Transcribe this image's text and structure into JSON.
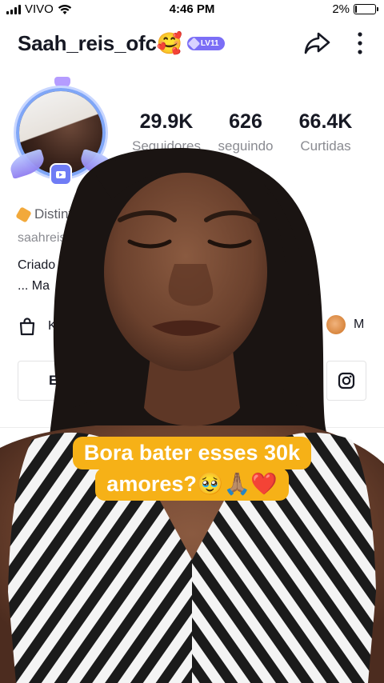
{
  "status_bar": {
    "carrier": "VIVO",
    "time": "4:46 PM",
    "battery_text": "2%",
    "battery_level": 0.02
  },
  "header": {
    "username": "Saah_reis_ofc🥰",
    "level_badge": "LV11"
  },
  "stats": [
    {
      "value": "29.9K",
      "label": "Seguidores"
    },
    {
      "value": "626",
      "label": "seguindo"
    },
    {
      "value": "66.4K",
      "label": "Curtidas"
    }
  ],
  "profile": {
    "distinction_partial": "Distinti",
    "handle_partial": "saahreis",
    "bio_line1_partial": "Criado",
    "bio_line2_partial": "... Ma",
    "shop_partial": "K",
    "right_link_partial": "M",
    "edit_button_partial": "E"
  },
  "caption": {
    "line1": "Bora bater esses 30k",
    "line2": "amores?🥹🙏🏽❤️"
  },
  "icons": [
    "wifi-icon",
    "share-icon",
    "more-icon",
    "shop-bag-icon",
    "instagram-icon",
    "shield-icon"
  ],
  "colors": {
    "level_badge": "#7b6ef6",
    "caption_bg": "#f6b117",
    "stat_label": "#8a8b91"
  }
}
